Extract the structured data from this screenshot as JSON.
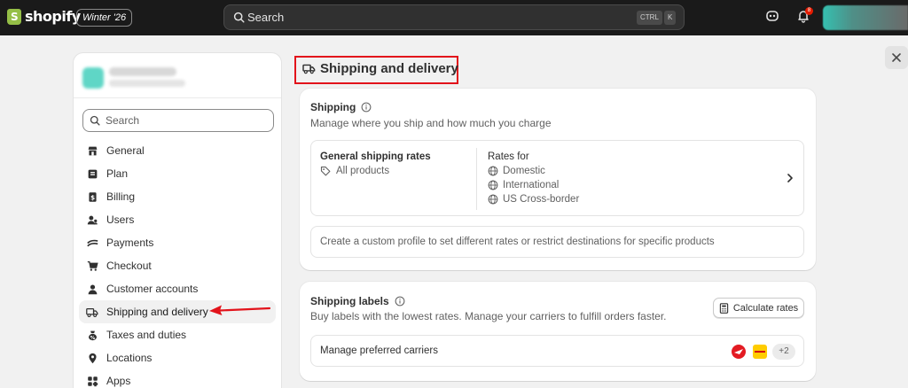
{
  "topbar": {
    "logo_text": "shopify",
    "edition": "Winter '26",
    "search_label": "Search",
    "shortcut_ctrl": "CTRL",
    "shortcut_k": "K",
    "notification_count": "8"
  },
  "sidebar": {
    "search_placeholder": "Search",
    "items": [
      {
        "label": "General",
        "icon": "store-icon"
      },
      {
        "label": "Plan",
        "icon": "plan-icon"
      },
      {
        "label": "Billing",
        "icon": "billing-icon"
      },
      {
        "label": "Users",
        "icon": "users-icon"
      },
      {
        "label": "Payments",
        "icon": "payments-icon"
      },
      {
        "label": "Checkout",
        "icon": "cart-icon"
      },
      {
        "label": "Customer accounts",
        "icon": "person-icon"
      },
      {
        "label": "Shipping and delivery",
        "icon": "truck-icon"
      },
      {
        "label": "Taxes and duties",
        "icon": "taxes-icon"
      },
      {
        "label": "Locations",
        "icon": "location-icon"
      },
      {
        "label": "Apps",
        "icon": "apps-icon"
      }
    ],
    "active_index": 7
  },
  "main": {
    "page_title": "Shipping and delivery",
    "shipping": {
      "title": "Shipping",
      "subtitle": "Manage where you ship and how much you charge",
      "general_rates_title": "General shipping rates",
      "general_rates_scope": "All products",
      "rates_for_label": "Rates for",
      "regions": [
        "Domestic",
        "International",
        "US Cross-border"
      ],
      "custom_profile_text": "Create a custom profile to set different rates or restrict destinations for specific products"
    },
    "labels": {
      "title": "Shipping labels",
      "subtitle": "Buy labels with the lowest rates. Manage your carriers to fulfill orders faster.",
      "calculate_button": "Calculate rates",
      "manage_carriers": "Manage preferred carriers",
      "more_carriers": "+2"
    }
  },
  "colors": {
    "topbar": "#1a1a1a",
    "highlight": "#e2131b",
    "logo_green": "#95bf47"
  }
}
